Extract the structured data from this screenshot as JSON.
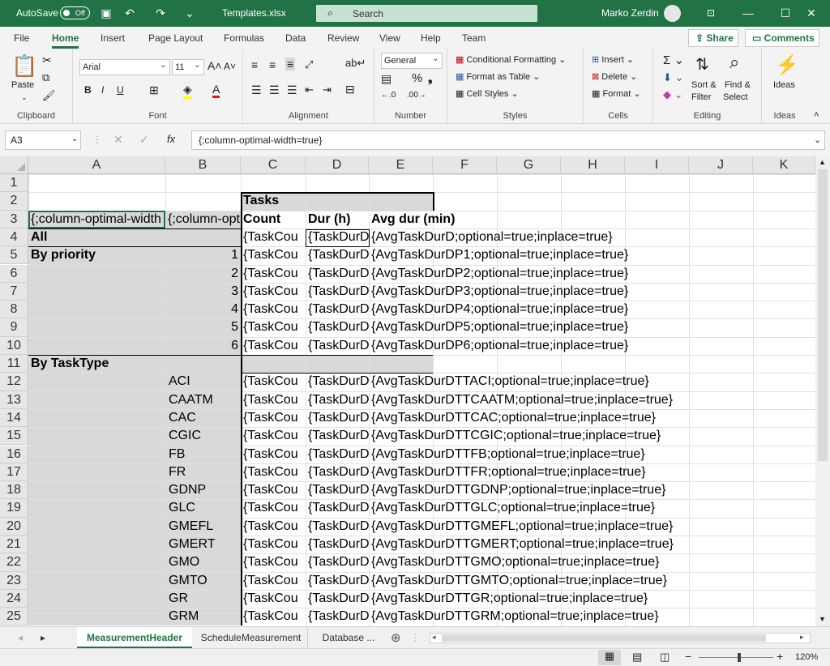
{
  "titlebar": {
    "autosave": "AutoSave",
    "autosave_state": "Off",
    "filename": "Templates.xlsx",
    "search_placeholder": "Search",
    "user": "Marko Zerdin"
  },
  "tabs": [
    "File",
    "Home",
    "Insert",
    "Page Layout",
    "Formulas",
    "Data",
    "Review",
    "View",
    "Help",
    "Team"
  ],
  "share": "Share",
  "comments": "Comments",
  "ribbon": {
    "clipboard": {
      "label": "Clipboard",
      "paste": "Paste"
    },
    "font": {
      "label": "Font",
      "family": "Arial",
      "size": "11"
    },
    "alignment": {
      "label": "Alignment"
    },
    "number": {
      "label": "Number",
      "format": "General"
    },
    "styles": {
      "label": "Styles",
      "conditional": "Conditional Formatting",
      "table": "Format as Table",
      "cell": "Cell Styles"
    },
    "cells": {
      "label": "Cells",
      "insert": "Insert",
      "delete": "Delete",
      "format": "Format"
    },
    "editing": {
      "label": "Editing",
      "sort1": "Sort &",
      "sort2": "Filter",
      "find1": "Find &",
      "find2": "Select"
    },
    "ideas": {
      "label": "Ideas",
      "button": "Ideas"
    }
  },
  "formula_bar": {
    "cell_ref": "A3",
    "content": "{;column-optimal-width=true}"
  },
  "columns": [
    "A",
    "B",
    "C",
    "D",
    "E",
    "F",
    "G",
    "H",
    "I",
    "J",
    "K"
  ],
  "rows": [
    "1",
    "2",
    "3",
    "4",
    "5",
    "6",
    "7",
    "8",
    "9",
    "10",
    "11",
    "12",
    "13",
    "14",
    "15",
    "16",
    "17",
    "18",
    "19",
    "20",
    "21",
    "22",
    "23",
    "24",
    "25"
  ],
  "cells": {
    "c2": "Tasks",
    "a3": "{;column-optimal-width",
    "b3": "{;column-opt",
    "c3": "Count",
    "d3": "Dur (h)",
    "e3": "Avg dur (min)",
    "a4": "All",
    "a5": "By priority",
    "a11": "By TaskType",
    "c_trunc": "{TaskCou",
    "d_trunc": "{TaskDurD",
    "e4": "{AvgTaskDurD;optional=true;inplace=true}",
    "priorities": [
      "1",
      "2",
      "3",
      "4",
      "5",
      "6"
    ],
    "e_priority": [
      "{AvgTaskDurDP1;optional=true;inplace=true}",
      "{AvgTaskDurDP2;optional=true;inplace=true}",
      "{AvgTaskDurDP3;optional=true;inplace=true}",
      "{AvgTaskDurDP4;optional=true;inplace=true}",
      "{AvgTaskDurDP5;optional=true;inplace=true}",
      "{AvgTaskDurDP6;optional=true;inplace=true}"
    ],
    "tasktypes": [
      "ACI",
      "CAATM",
      "CAC",
      "CGIC",
      "FB",
      "FR",
      "GDNP",
      "GLC",
      "GMEFL",
      "GMERT",
      "GMO",
      "GMTO",
      "GR",
      "GRM"
    ],
    "e_tasktype": [
      "{AvgTaskDurDTTACI;optional=true;inplace=true}",
      "{AvgTaskDurDTTCAATM;optional=true;inplace=true}",
      "{AvgTaskDurDTTCAC;optional=true;inplace=true}",
      "{AvgTaskDurDTTCGIC;optional=true;inplace=true}",
      "{AvgTaskDurDTTFB;optional=true;inplace=true}",
      "{AvgTaskDurDTTFR;optional=true;inplace=true}",
      "{AvgTaskDurDTTGDNP;optional=true;inplace=true}",
      "{AvgTaskDurDTTGLC;optional=true;inplace=true}",
      "{AvgTaskDurDTTGMEFL;optional=true;inplace=true}",
      "{AvgTaskDurDTTGMERT;optional=true;inplace=true}",
      "{AvgTaskDurDTTGMO;optional=true;inplace=true}",
      "{AvgTaskDurDTTGMTO;optional=true;inplace=true}",
      "{AvgTaskDurDTTGR;optional=true;inplace=true}",
      "{AvgTaskDurDTTGRM;optional=true;inplace=true}"
    ]
  },
  "sheet_tabs": [
    "MeasurementHeader",
    "ScheduleMeasurement",
    "Database ..."
  ],
  "status": {
    "zoom": "120%"
  }
}
